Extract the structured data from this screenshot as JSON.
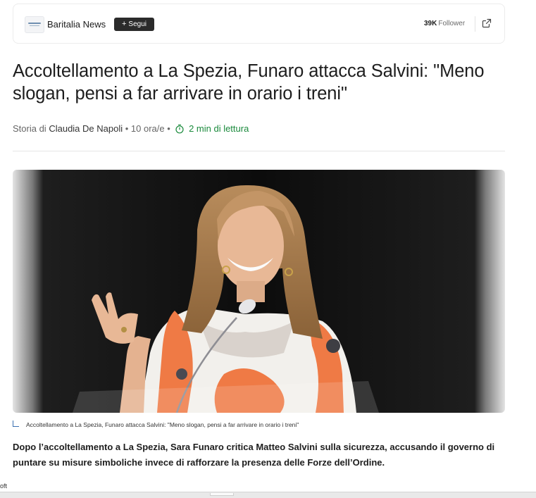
{
  "publisher": {
    "name": "Baritalia News",
    "follow_label": "Segui",
    "followers_count": "39K",
    "followers_label": "Follower"
  },
  "article": {
    "title": "Accoltellamento a La Spezia, Funaro attacca Salvini: \"Meno slogan, pensi a far arrivare in orario i treni\"",
    "byline": {
      "prefix": "Storia di",
      "author": "Claudia De Napoli",
      "time": "10 ora/e",
      "read_time": "2 min di lettura"
    },
    "image_caption": "Accoltellamento a La Spezia, Funaro attacca Salvini: \"Meno slogan, pensi a far arrivare in orario i treni\"",
    "lead": "Dopo l’accoltellamento a La Spezia, Sara Funaro critica Matteo Salvini sulla sicurezza, accusando il governo di puntare su misure simboliche invece di rafforzare la presenza delle Forze dell’Ordine."
  },
  "footer": {
    "partial_text": "oft"
  },
  "icons": {
    "share": "external-link-icon",
    "clock": "timer-icon",
    "plus": "plus-icon"
  },
  "colors": {
    "read_time": "#1a8a3c",
    "follow_button": "#2b2b2b",
    "caption_mark": "#3a6fb0"
  }
}
